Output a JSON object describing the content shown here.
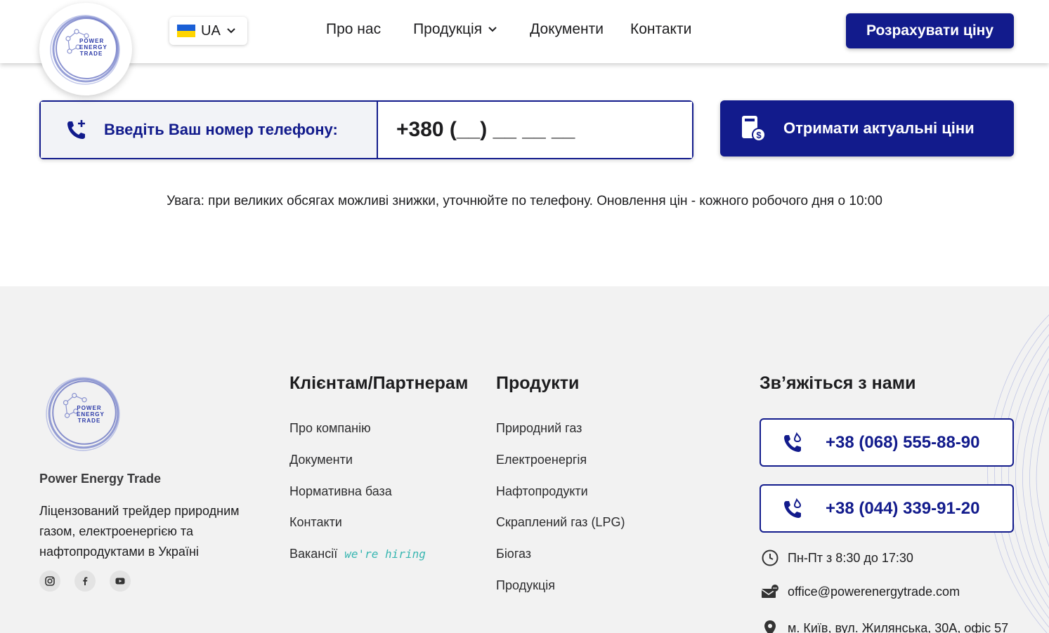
{
  "brand": {
    "logo_line1": "POWER",
    "logo_line2": "ENERGY",
    "logo_line3": "TRADE"
  },
  "header": {
    "language": "UA",
    "nav": [
      {
        "label": "Про нас"
      },
      {
        "label": "Продукція",
        "has_dropdown": true
      },
      {
        "label": "Документи"
      },
      {
        "label": "Контакти"
      }
    ],
    "cta_label": "Розрахувати ціну"
  },
  "phone_form": {
    "label": "Введіть Ваш номер телефону:",
    "value": "+380 (__) __ __ __",
    "button_label": "Отримати актуальні ціни"
  },
  "notice": "Увага: при великих обсягах можливі знижки, уточнюйте по телефону. Оновлення цін - кожного робочого дня о 10:00",
  "footer": {
    "company_name": "Power Energy Trade",
    "description": "Ліцензований трейдер природним газом, електроенергією та нафтопродуктами в Україні",
    "socials": [
      "instagram-icon",
      "facebook-icon",
      "youtube-icon"
    ],
    "clients": {
      "title": "Клієнтам/Партнерам",
      "links": [
        "Про компанію",
        "Документи",
        "Нормативна база",
        "Контакти",
        "Вакансії"
      ],
      "hiring_badge": "we're hiring"
    },
    "products": {
      "title": "Продукти",
      "links": [
        "Природний газ",
        "Електроенергія",
        "Нафтопродукти",
        "Скраплений газ (LPG)",
        "Біогаз",
        "Продукція"
      ]
    },
    "contact": {
      "title": "Зв’яжіться з нами",
      "phones": [
        "+38 (068) 555-88-90",
        "+38 (044) 339-91-20"
      ],
      "hours": "Пн-Пт з 8:30 до 17:30",
      "email": "office@powerenergytrade.com",
      "address": "м. Київ, вул. Жилянська, 30А, офіс 57"
    }
  },
  "colors": {
    "primary": "#121b8c",
    "accent_hiring": "#38b6b1",
    "footer_bg": "#f2f2f2"
  }
}
